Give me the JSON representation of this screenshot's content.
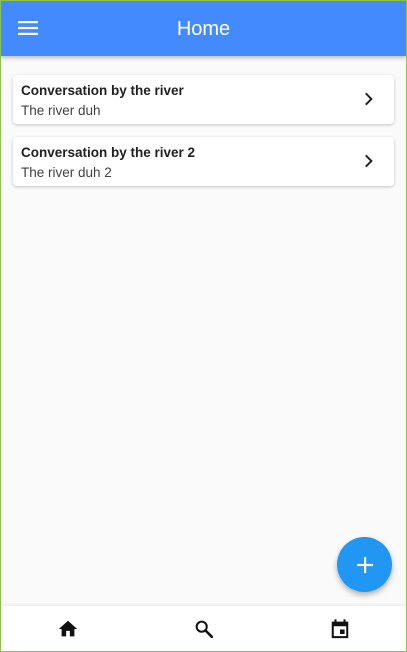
{
  "app_bar": {
    "title": "Home",
    "menu_icon": "hamburger-menu-icon",
    "background_color": "#448aff"
  },
  "conversations": [
    {
      "title": "Conversation by the river",
      "subtitle": "The river duh"
    },
    {
      "title": "Conversation by the river 2",
      "subtitle": "The river duh 2"
    }
  ],
  "fab": {
    "icon": "plus-icon",
    "color": "#2196f3"
  },
  "bottom_nav": {
    "items": [
      {
        "icon": "home-icon"
      },
      {
        "icon": "search-icon"
      },
      {
        "icon": "calendar-icon"
      }
    ]
  }
}
